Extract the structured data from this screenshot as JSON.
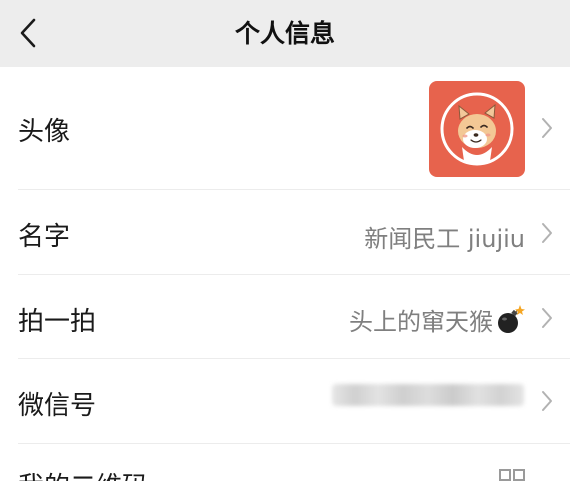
{
  "header": {
    "title": "个人信息",
    "back_icon": "chevron-left-icon"
  },
  "profile": {
    "avatar": {
      "label": "头像",
      "image": "shiba-dog-avatar",
      "background_color": "#e7634d"
    },
    "name": {
      "label": "名字",
      "value": "新闻民工 jiujiu"
    },
    "pat": {
      "label": "拍一拍",
      "value": "头上的窜天猴",
      "icon": "bomb-icon"
    },
    "wechat_id": {
      "label": "微信号",
      "value": ""
    },
    "partial_row": {
      "label": "我的二维码"
    }
  },
  "colors": {
    "nav_background": "#ededed",
    "label_text": "#1a1a1a",
    "value_text": "#7f7f7f",
    "chevron": "#b2b2b2",
    "divider": "#ececec"
  }
}
